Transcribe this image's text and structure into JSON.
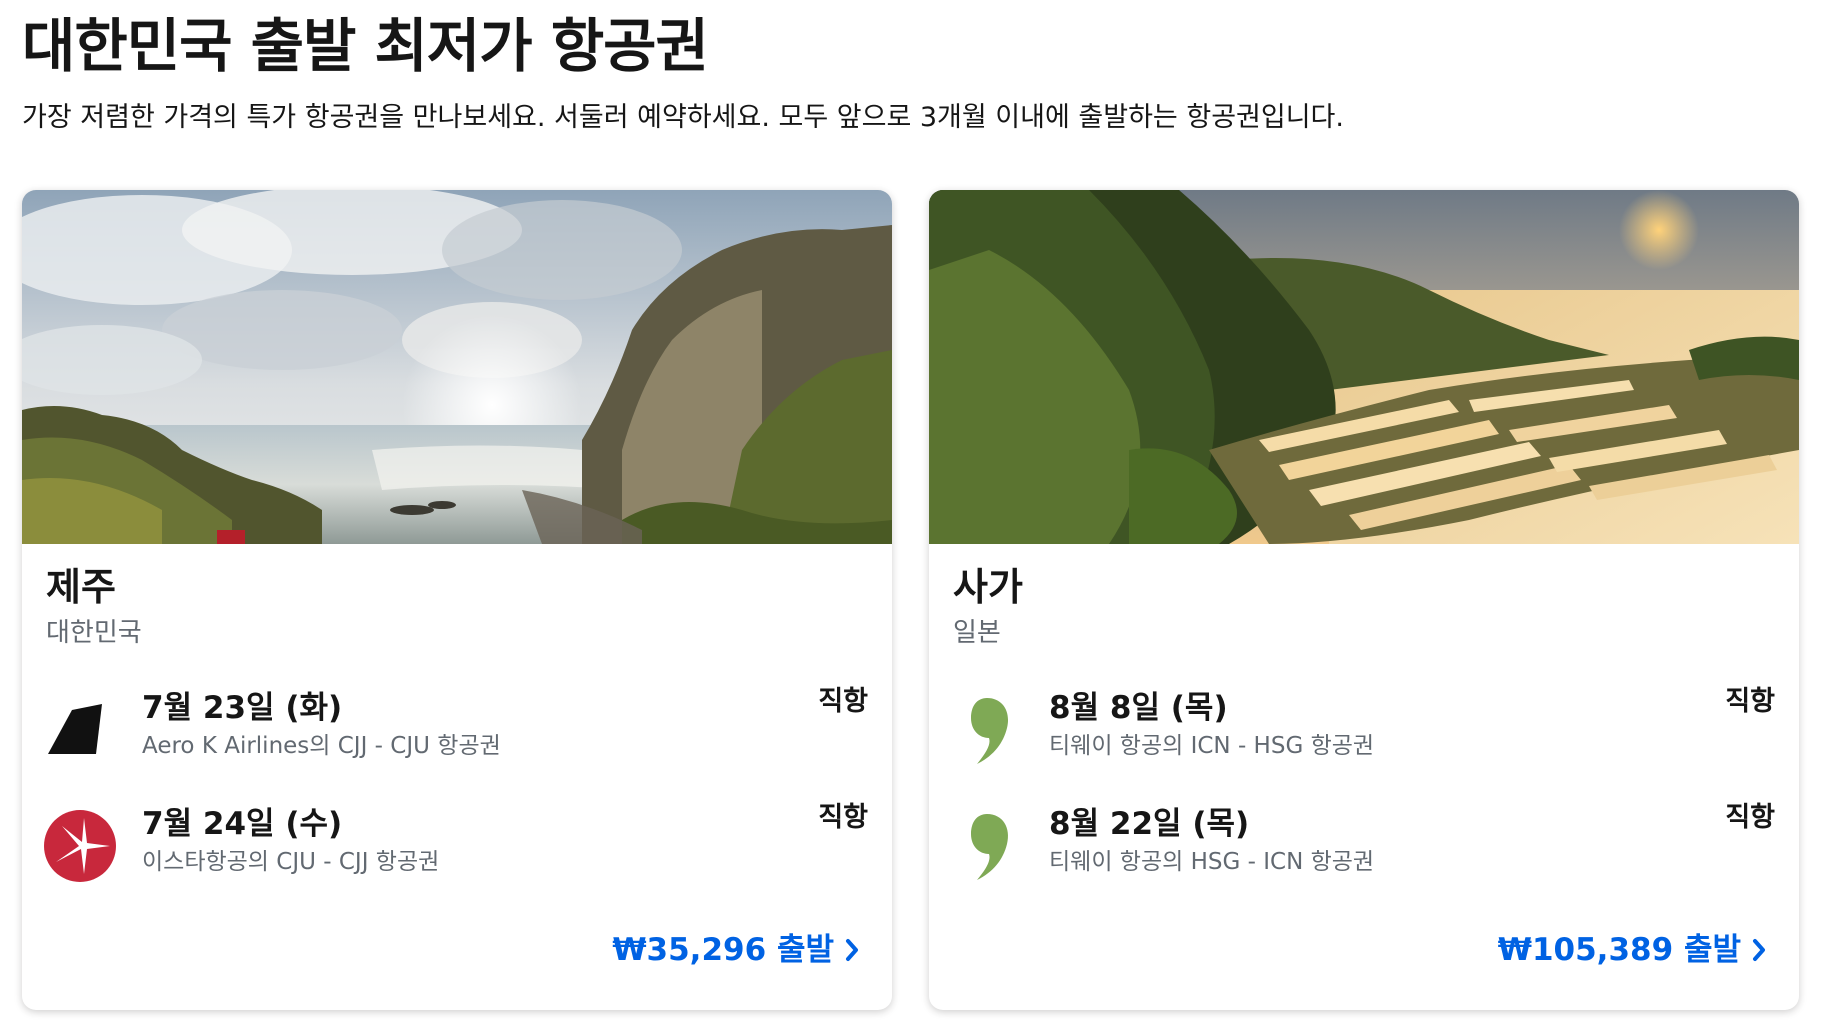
{
  "header": {
    "title": "대한민국 출발 최저가 항공권",
    "subtitle": "가장 저렴한 가격의 특가 항공권을 만나보세요. 서둘러 예약하세요. 모두 앞으로 3개월 이내에 출발하는 항공권입니다."
  },
  "cards": [
    {
      "image_subject": "jeju-coastal-cliff-photo",
      "city": "제주",
      "country": "대한민국",
      "flights": [
        {
          "date": "7월 23일 (화)",
          "route": "Aero K Airlines의 CJJ - CJU 항공권",
          "stops": "직항",
          "airline_icon": "aero-k-airlines-logo-icon"
        },
        {
          "date": "7월 24일 (수)",
          "route": "이스타항공의 CJU - CJJ 항공권",
          "stops": "직항",
          "airline_icon": "eastar-jet-logo-icon"
        }
      ],
      "price_label": "₩35,296 출발"
    },
    {
      "image_subject": "saga-rice-terraces-sunset-photo",
      "city": "사가",
      "country": "일본",
      "flights": [
        {
          "date": "8월 8일 (목)",
          "route": "티웨이 항공의 ICN - HSG 항공권",
          "stops": "직항",
          "airline_icon": "tway-air-logo-icon"
        },
        {
          "date": "8월 22일 (목)",
          "route": "티웨이 항공의 HSG - ICN 항공권",
          "stops": "직항",
          "airline_icon": "tway-air-logo-icon"
        }
      ],
      "price_label": "₩105,389 출발"
    }
  ],
  "colors": {
    "price_link": "#0062e3",
    "text_primary": "#161616",
    "text_secondary": "#626971",
    "eastar_red": "#c8283c",
    "tway_green": "#7fa955"
  }
}
